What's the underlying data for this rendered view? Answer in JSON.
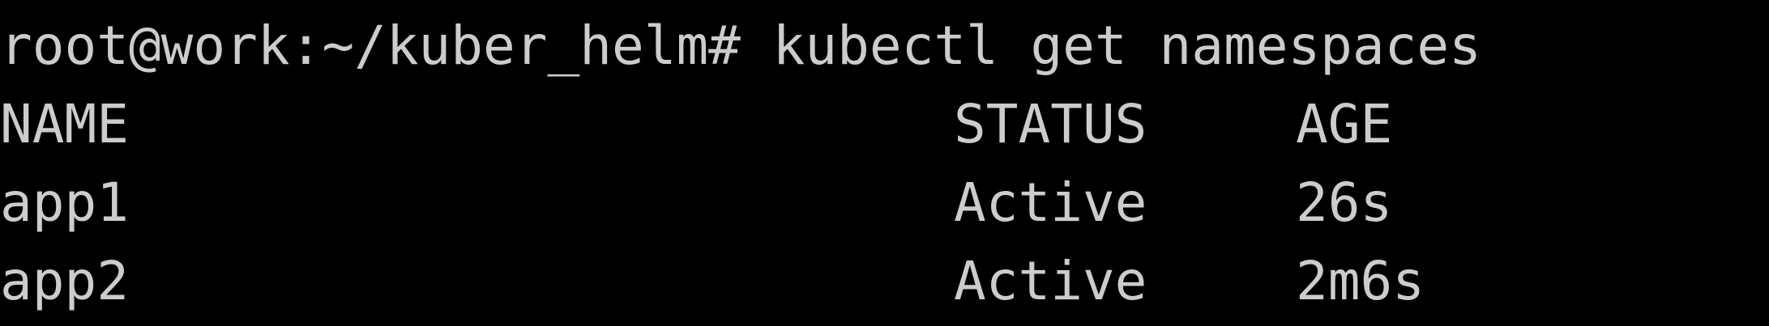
{
  "terminal": {
    "prompt": "root@work:~/kuber_helm#",
    "command": "kubectl get namespaces",
    "headers": {
      "name": "NAME",
      "status": "STATUS",
      "age": "AGE"
    },
    "rows": [
      {
        "name": "app1",
        "status": "Active",
        "age": "26s"
      },
      {
        "name": "app2",
        "status": "Active",
        "age": "2m6s"
      }
    ]
  },
  "colors": {
    "background": "#000000",
    "text": "#cccccc"
  }
}
